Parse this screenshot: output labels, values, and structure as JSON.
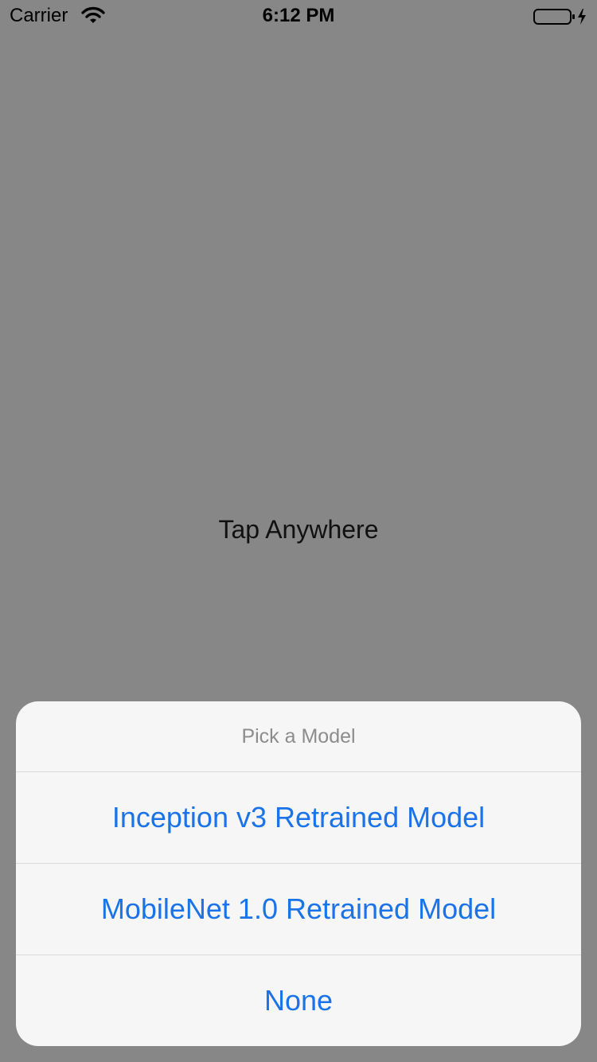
{
  "status_bar": {
    "carrier": "Carrier",
    "time": "6:12 PM",
    "wifi_icon": "wifi-icon",
    "battery_icon": "battery-icon",
    "charging_icon": "lightning-bolt-icon"
  },
  "main": {
    "prompt": "Tap Anywhere"
  },
  "action_sheet": {
    "title": "Pick a Model",
    "options": [
      {
        "label": "Inception v3 Retrained Model"
      },
      {
        "label": "MobileNet 1.0 Retrained Model"
      },
      {
        "label": "None"
      }
    ]
  },
  "colors": {
    "background": "#878787",
    "sheet_background": "#f6f6f6",
    "option_text": "#1a73e8",
    "title_text": "#8c8c8c"
  }
}
